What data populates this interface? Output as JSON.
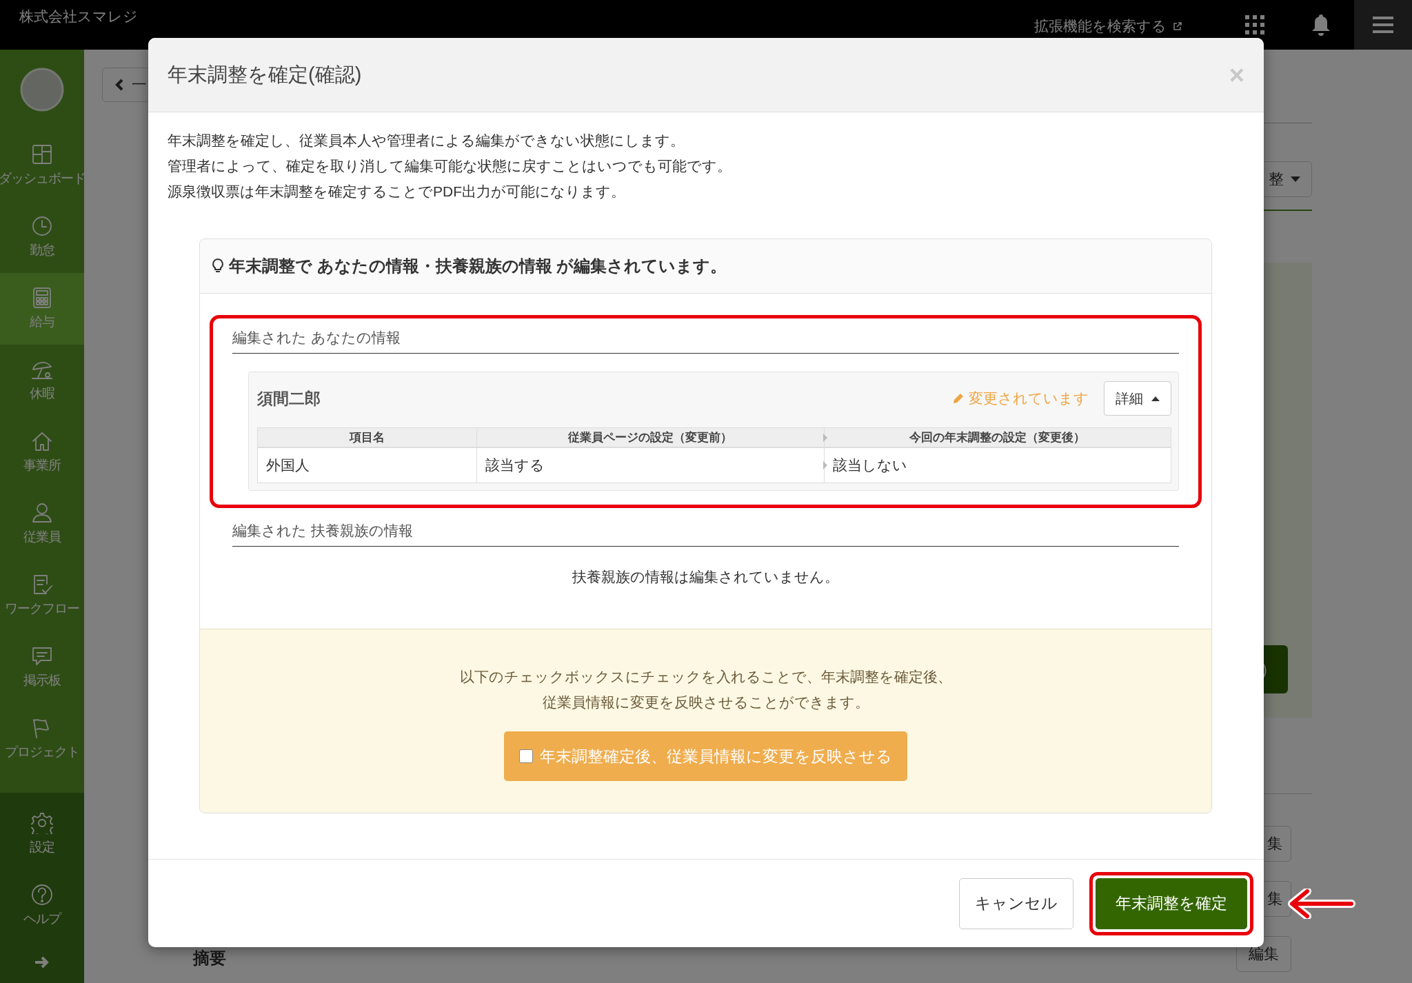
{
  "top_bar": {
    "company": "株式会社スマレジ",
    "extension_search": "拡張機能を検索する"
  },
  "sidebar": {
    "items": [
      {
        "label": "ダッシュボード",
        "kind": "dashboard",
        "selected": false
      },
      {
        "label": "勤怠",
        "kind": "clock",
        "selected": false
      },
      {
        "label": "給与",
        "kind": "calculator",
        "selected": true
      },
      {
        "label": "休暇",
        "kind": "umbrella",
        "selected": false
      },
      {
        "label": "事業所",
        "kind": "house",
        "selected": false
      },
      {
        "label": "従業員",
        "kind": "person",
        "selected": false
      },
      {
        "label": "ワークフロー",
        "kind": "clipboard",
        "selected": false
      },
      {
        "label": "掲示板",
        "kind": "chat",
        "selected": false
      },
      {
        "label": "プロジェクト",
        "kind": "flag",
        "selected": false
      }
    ],
    "bottom_items": [
      {
        "label": "設定",
        "kind": "gear"
      },
      {
        "label": "ヘルプ",
        "kind": "help"
      }
    ]
  },
  "background": {
    "back_button": "一",
    "dropdown": "整",
    "action_button": ")",
    "edit_buttons": [
      "集",
      "集",
      "編集"
    ],
    "section_label": "摘要"
  },
  "modal": {
    "title": "年末調整を確定(確認)",
    "close": "×",
    "description": [
      "年末調整を確定し、従業員本人や管理者による編集ができない状態にします。",
      "管理者によって、確定を取り消して編集可能な状態に戻すことはいつでも可能です。",
      "源泉徴収票は年末調整を確定することでPDF出力が可能になります。"
    ],
    "notice": "年末調整で あなたの情報・扶養親族の情報 が編集されています。",
    "sections": [
      {
        "title": "編集された あなたの情報",
        "highlighted": true,
        "employee": {
          "name": "須間二郎",
          "status": "変更されています",
          "details_button": "詳細",
          "expanded": true,
          "columns": [
            "項目名",
            "従業員ページの設定（変更前）",
            "今回の年末調整の設定（変更後）"
          ],
          "rows": [
            [
              "外国人",
              "該当する",
              "該当しない"
            ]
          ]
        }
      },
      {
        "title": "編集された 扶養親族の情報",
        "highlighted": false,
        "empty_message": "扶養親族の情報は編集されていません。"
      }
    ],
    "reflect": {
      "message": [
        "以下のチェックボックスにチェックを入れることで、年末調整を確定後、",
        "従業員情報に変更を反映させることができます。"
      ],
      "checkbox": {
        "label": "年末調整確定後、従業員情報に変更を反映させる",
        "checked": false
      }
    },
    "buttons": [
      {
        "label": "キャンセル",
        "kind": "default",
        "highlighted": false
      },
      {
        "label": "年末調整を確定",
        "kind": "primary",
        "highlighted": true
      }
    ]
  }
}
